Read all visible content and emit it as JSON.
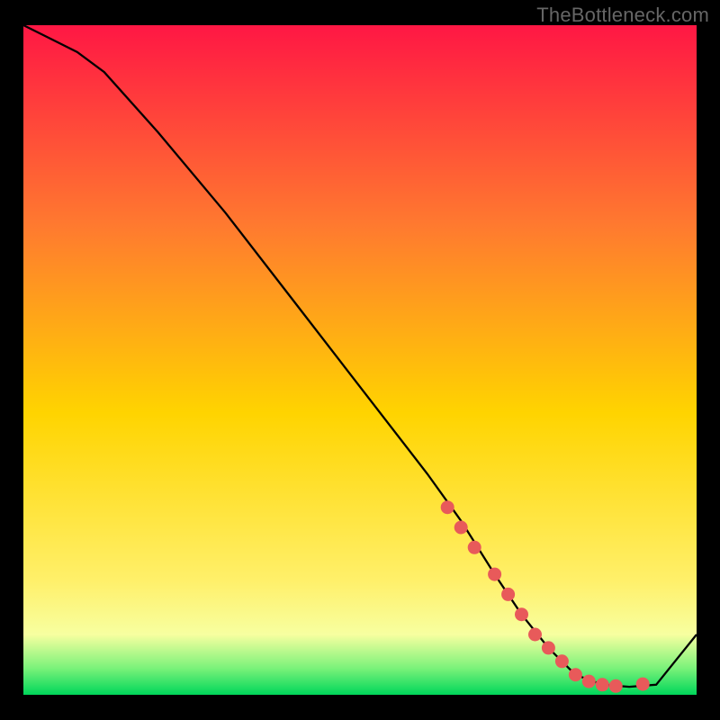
{
  "watermark": "TheBottleneck.com",
  "colors": {
    "frame": "#000000",
    "curve": "#000000",
    "marker_fill": "#e85a5a",
    "marker_stroke": "#c74545",
    "grad_top": "#ff1744",
    "grad_mid_upper": "#ff7a2f",
    "grad_mid": "#ffd400",
    "grad_lowband_top": "#fff06a",
    "grad_lowband_bot": "#f7ffa0",
    "grad_green_top": "#7bf27a",
    "grad_green_bot": "#00d65a"
  },
  "chart_data": {
    "type": "line",
    "title": "",
    "xlabel": "",
    "ylabel": "",
    "ylim": [
      0,
      100
    ],
    "xlim": [
      0,
      100
    ],
    "series": [
      {
        "name": "curve",
        "x": [
          0,
          4,
          8,
          12,
          20,
          30,
          40,
          50,
          60,
          65,
          70,
          74,
          78,
          82,
          86,
          90,
          94,
          100
        ],
        "y": [
          100,
          98,
          96,
          93,
          84,
          72,
          59,
          46,
          33,
          26,
          18,
          12,
          7,
          3,
          1.5,
          1.2,
          1.5,
          9
        ]
      }
    ],
    "markers": {
      "name": "highlighted-points",
      "x": [
        63,
        65,
        67,
        70,
        72,
        74,
        76,
        78,
        80,
        82,
        84,
        86,
        88,
        92
      ],
      "y": [
        28,
        25,
        22,
        18,
        15,
        12,
        9,
        7,
        5,
        3,
        2,
        1.5,
        1.3,
        1.6
      ]
    }
  }
}
